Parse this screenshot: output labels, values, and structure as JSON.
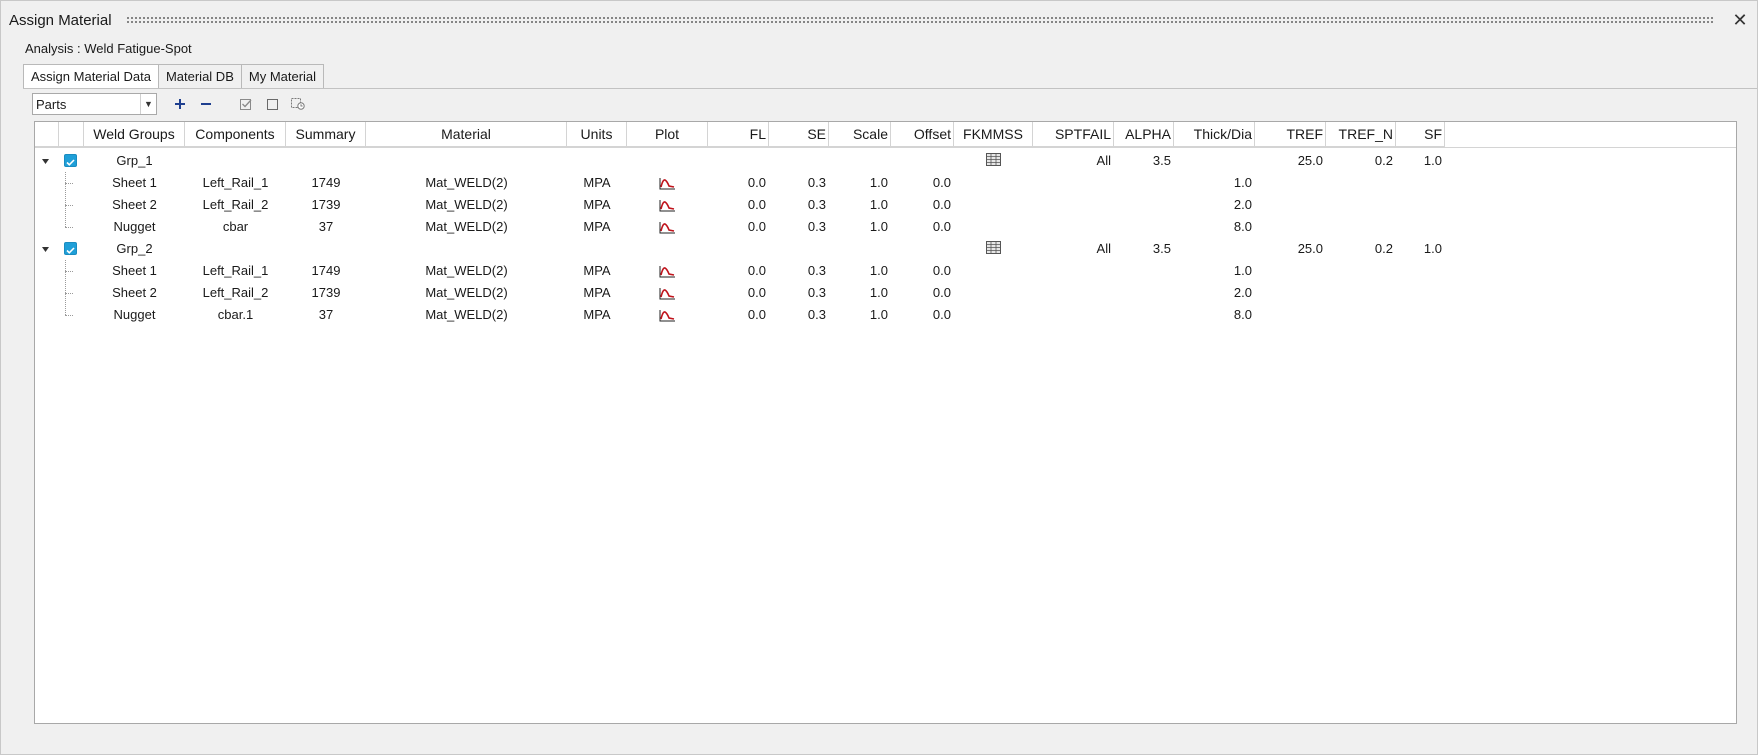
{
  "window": {
    "title": "Assign Material",
    "close_glyph": "✕"
  },
  "analysis_label": "Analysis : Weld Fatigue-Spot",
  "tabs": [
    {
      "label": "Assign Material Data",
      "active": true
    },
    {
      "label": "Material DB",
      "active": false
    },
    {
      "label": "My Material",
      "active": false
    }
  ],
  "toolbar": {
    "selector_value": "Parts",
    "add_icon": "plus-icon",
    "remove_icon": "minus-icon",
    "check_all_icon": "check-all-icon",
    "uncheck_all_icon": "uncheck-all-icon",
    "reset_icon": "reset-icon"
  },
  "table": {
    "columns": [
      "",
      "",
      "Weld Groups",
      "Components",
      "Summary",
      "Material",
      "Units",
      "Plot",
      "FL",
      "SE",
      "Scale",
      "Offset",
      "FKMMSS",
      "SPTFAIL",
      "ALPHA",
      "Thick/Dia",
      "TREF",
      "TREF_N",
      "SF"
    ],
    "groups": [
      {
        "name": "Grp_1",
        "checked": true,
        "fkmmss_icon": "table-icon",
        "sptfail": "All",
        "alpha": "3.5",
        "tref": "25.0",
        "tref_n": "0.2",
        "sf": "1.0",
        "rows": [
          {
            "weld": "Sheet 1",
            "component": "Left_Rail_1",
            "summary": "1749",
            "material": "Mat_WELD(2)",
            "units": "MPA",
            "fl": "0.0",
            "se": "0.3",
            "scale": "1.0",
            "offset": "0.0",
            "thick": "1.0"
          },
          {
            "weld": "Sheet 2",
            "component": "Left_Rail_2",
            "summary": "1739",
            "material": "Mat_WELD(2)",
            "units": "MPA",
            "fl": "0.0",
            "se": "0.3",
            "scale": "1.0",
            "offset": "0.0",
            "thick": "2.0"
          },
          {
            "weld": "Nugget",
            "component": "cbar",
            "summary": "37",
            "material": "Mat_WELD(2)",
            "units": "MPA",
            "fl": "0.0",
            "se": "0.3",
            "scale": "1.0",
            "offset": "0.0",
            "thick": "8.0"
          }
        ]
      },
      {
        "name": "Grp_2",
        "checked": true,
        "fkmmss_icon": "table-icon",
        "sptfail": "All",
        "alpha": "3.5",
        "tref": "25.0",
        "tref_n": "0.2",
        "sf": "1.0",
        "rows": [
          {
            "weld": "Sheet 1",
            "component": "Left_Rail_1",
            "summary": "1749",
            "material": "Mat_WELD(2)",
            "units": "MPA",
            "fl": "0.0",
            "se": "0.3",
            "scale": "1.0",
            "offset": "0.0",
            "thick": "1.0"
          },
          {
            "weld": "Sheet 2",
            "component": "Left_Rail_2",
            "summary": "1739",
            "material": "Mat_WELD(2)",
            "units": "MPA",
            "fl": "0.0",
            "se": "0.3",
            "scale": "1.0",
            "offset": "0.0",
            "thick": "2.0"
          },
          {
            "weld": "Nugget",
            "component": "cbar.1",
            "summary": "37",
            "material": "Mat_WELD(2)",
            "units": "MPA",
            "fl": "0.0",
            "se": "0.3",
            "scale": "1.0",
            "offset": "0.0",
            "thick": "8.0"
          }
        ]
      }
    ]
  },
  "colors": {
    "checkbox": "#1f9fd8",
    "plot_icon": "#c0141c",
    "accent_icon": "#1f3f8f"
  }
}
